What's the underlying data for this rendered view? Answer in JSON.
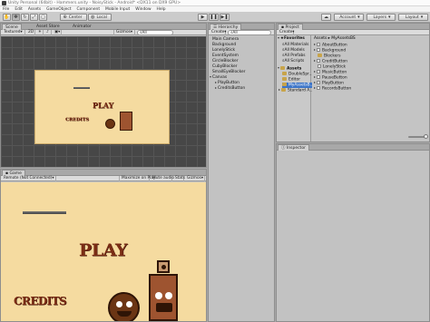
{
  "window": {
    "title": "Unity Personal (64bit) - Hammers.unity - NoisyStick - Android* <DX11 on DX9 GPU>"
  },
  "menubar": {
    "items": [
      "File",
      "Edit",
      "Assets",
      "GameObject",
      "Component",
      "Mobile Input",
      "Window",
      "Help"
    ]
  },
  "toolbar": {
    "pivot_label": "Center",
    "space_label": "Local",
    "account_label": "Account",
    "layers_label": "Layers",
    "layout_label": "Layout"
  },
  "scene": {
    "tabs": [
      "Scene",
      "Asset Store",
      "Animator"
    ],
    "shading_label": "Textured",
    "mode_label": "2D",
    "gizmos_label": "Gizmos",
    "search_placeholder": "All"
  },
  "game": {
    "tab_label": "Game",
    "display_label": "Remote (Not Connected)",
    "maximize_label": "Maximize on Play",
    "mute_label": "Mute audio",
    "stats_label": "Stats",
    "gizmos_label": "Gizmos"
  },
  "game_texts": {
    "play": "PLAY",
    "credits": "CREDITS"
  },
  "hierarchy": {
    "tab_label": "Hierarchy",
    "create_label": "Create",
    "search_placeholder": "All",
    "items": [
      "Main Camera",
      "Background",
      "LonelyStick",
      "EventSystem",
      "CircleBlocker",
      "CubyBlocker",
      "SmallEyeBlocker",
      "Canvas",
      "PlayButton",
      "CreditsButton"
    ]
  },
  "project": {
    "tab_label": "Project",
    "create_label": "Create",
    "favorites": {
      "label": "Favorites",
      "items": [
        "All Materials",
        "All Models",
        "All Prefabs",
        "All Scripts"
      ]
    },
    "assets_tree": {
      "label": "Assets",
      "items": [
        "DoubleSpr...",
        "Editor",
        "MyAssetsB...",
        "Standard A..."
      ]
    },
    "breadcrumb": "Assets ▸ MyAssetsBS",
    "files": [
      "AboutButton",
      "Background",
      "Blockers",
      "CreditButton",
      "LonelyStick",
      "MusicButton",
      "PauseButton",
      "PlayButton",
      "RecordsButton"
    ]
  },
  "inspector": {
    "tab_label": "Inspector"
  },
  "colors": {
    "game_bg": "#f5dba0",
    "scene_grid": "#4a4a4a",
    "accent_text": "#7a2c14",
    "panel": "#c2c2c2"
  }
}
